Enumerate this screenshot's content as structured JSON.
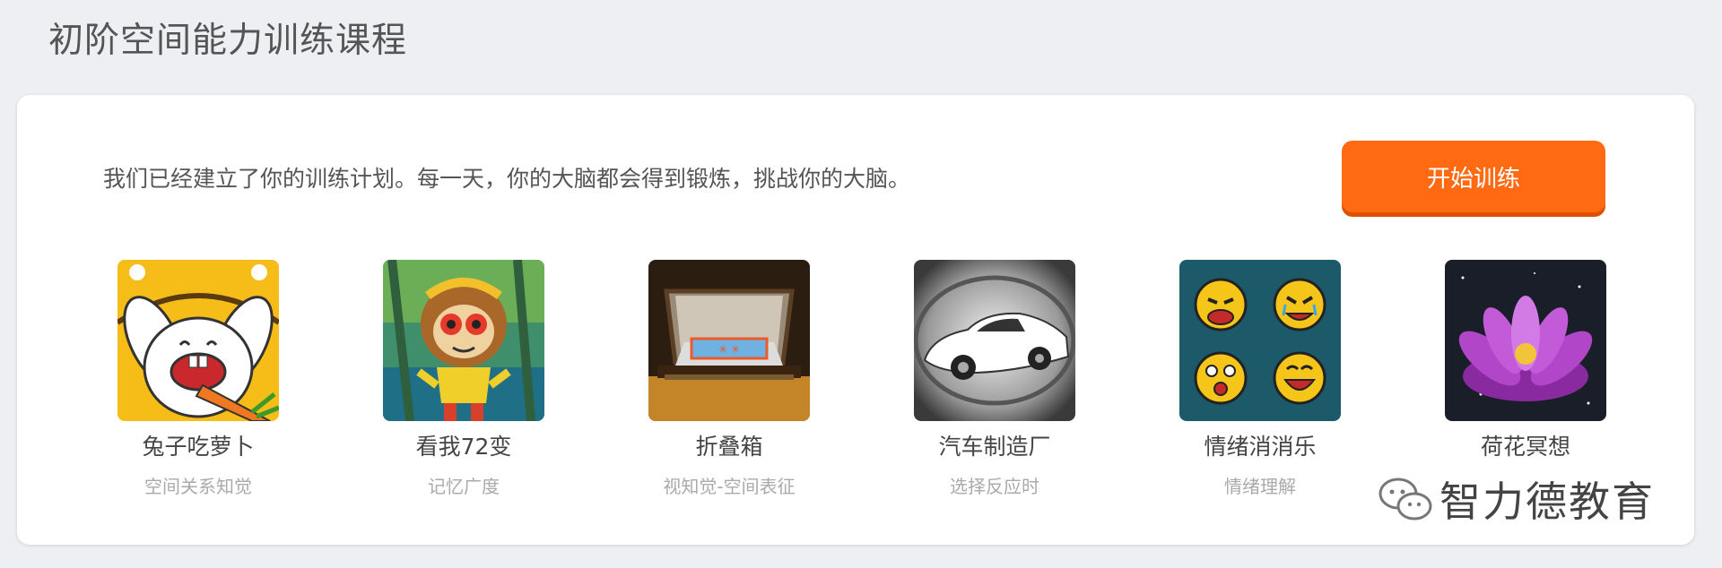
{
  "page": {
    "title": "初阶空间能力训练课程"
  },
  "card": {
    "intro": "我们已经建立了你的训练计划。每一天，你的大脑都会得到锻炼，挑战你的大脑。",
    "start_button": "开始训练"
  },
  "games": [
    {
      "name": "兔子吃萝卜",
      "category": "空间关系知觉",
      "icon": "rabbit-carrot-icon"
    },
    {
      "name": "看我72变",
      "category": "记忆广度",
      "icon": "monkey-king-icon"
    },
    {
      "name": "折叠箱",
      "category": "视知觉-空间表征",
      "icon": "folding-box-icon"
    },
    {
      "name": "汽车制造厂",
      "category": "选择反应时",
      "icon": "sports-car-icon"
    },
    {
      "name": "情绪消消乐",
      "category": "情绪理解",
      "icon": "emoji-faces-icon"
    },
    {
      "name": "荷花冥想",
      "category": "",
      "icon": "lotus-icon"
    }
  ],
  "watermark": {
    "text": "智力德教育"
  },
  "colors": {
    "accent": "#ff6a13",
    "background": "#eeeff3"
  }
}
